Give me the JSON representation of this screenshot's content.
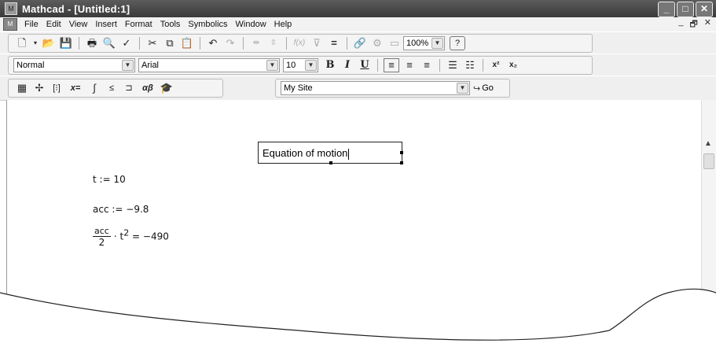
{
  "window": {
    "title": "Mathcad - [Untitled:1]",
    "controls": [
      "_",
      "□",
      "✕"
    ]
  },
  "menubar": {
    "items": [
      "File",
      "Edit",
      "View",
      "Insert",
      "Format",
      "Tools",
      "Symbolics",
      "Window",
      "Help"
    ],
    "mdi_controls": [
      "_",
      "🗗",
      "✕"
    ]
  },
  "standard_toolbar": {
    "zoom": "100%"
  },
  "formatting_toolbar": {
    "style": "Normal",
    "font": "Arial",
    "size": "10",
    "bold": "B",
    "italic": "I",
    "underline": "U",
    "superscript": "x²",
    "subscript": "x₂"
  },
  "math_toolbar": {
    "xequals": "x=",
    "greek": "αβ",
    "resource_site": "My Site",
    "go_label": "Go"
  },
  "worksheet": {
    "text_region": "Equation of motion",
    "line1": "t := 10",
    "line2": "acc := −9.8",
    "expr_num": "acc",
    "expr_den": "2",
    "expr_tail": "· t",
    "expr_exp": "2",
    "expr_result": "= −490"
  }
}
